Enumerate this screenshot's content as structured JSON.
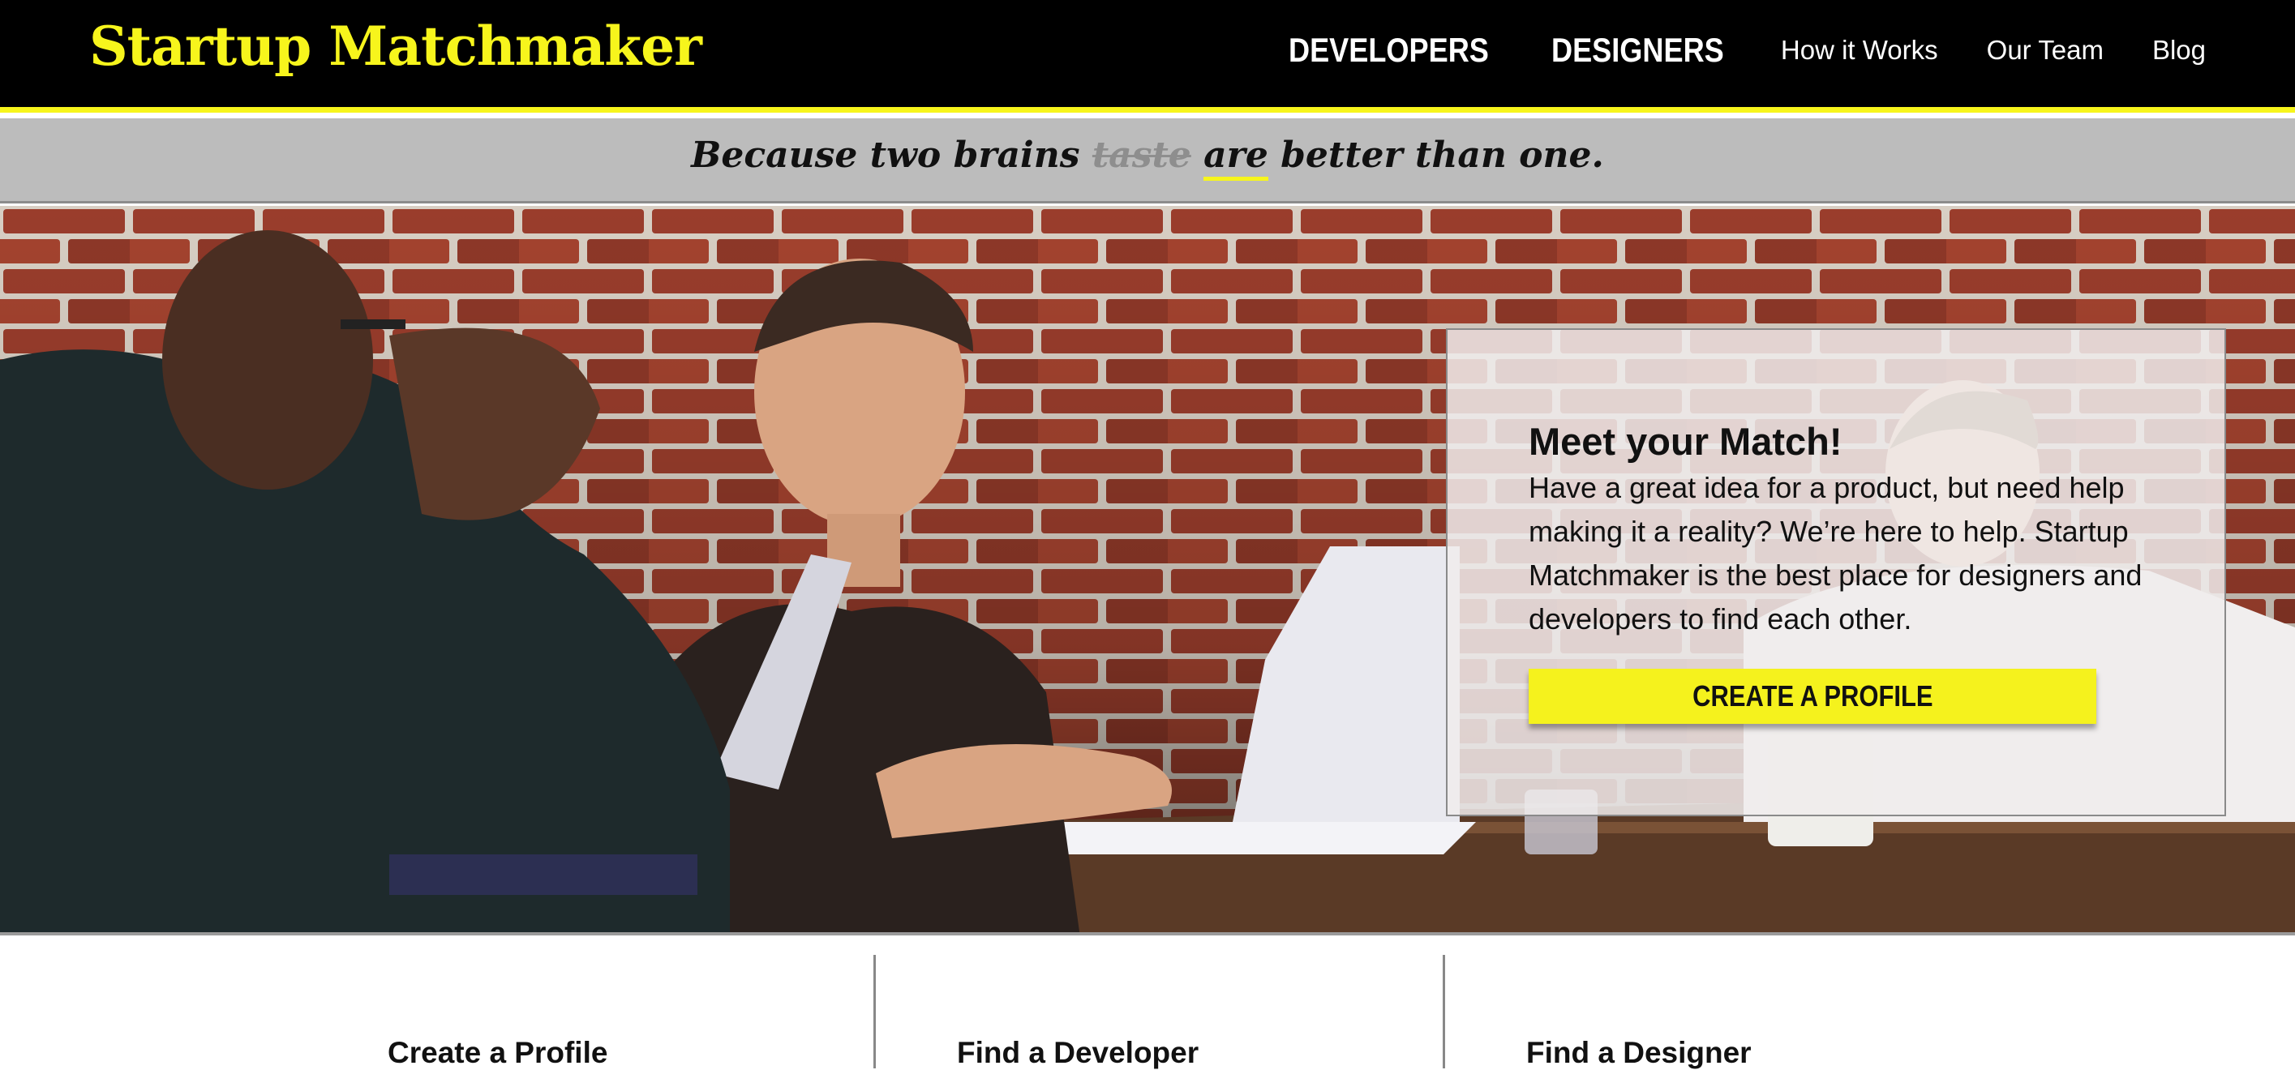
{
  "header": {
    "logo": "Startup Matchmaker",
    "nav": {
      "developers": "DEVELOPERS",
      "designers": "DESIGNERS",
      "how_it_works": "How it Works",
      "our_team": "Our Team",
      "blog": "Blog"
    }
  },
  "tagline": {
    "before": "Because two brains ",
    "struck": "taste",
    "space": " ",
    "underlined": "are",
    "after": " better than one."
  },
  "hero": {
    "card": {
      "title": "Meet your Match!",
      "body": "Have a great idea for a product, but need help making it a reality? We’re here to help. Startup Matchmaker is the best place for designers and developers to find each other.",
      "button": "CREATE A PROFILE"
    }
  },
  "features": [
    {
      "title": "Create a Profile"
    },
    {
      "title": "Find a Developer"
    },
    {
      "title": "Find a Designer"
    }
  ],
  "colors": {
    "accent": "#f7f51c",
    "header_bg": "#000000",
    "tagline_bg": "#bcbcbc"
  }
}
